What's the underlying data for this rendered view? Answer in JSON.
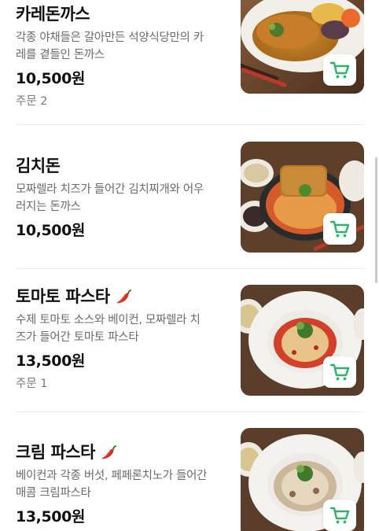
{
  "colors": {
    "accent": "#2fb36b",
    "pepper": "#d9321f"
  },
  "items": [
    {
      "name": "카레돈까스",
      "desc_line1": "각종 야채들은 갈아만든 석양식당만의 카",
      "desc_line2": "레를 곁들인 돈까스",
      "price": "10,500원",
      "order": "주문 2",
      "spicy": false,
      "image": "curry-tonkatsu-photo"
    },
    {
      "name": "김치돈",
      "desc_line1": "모짜렐라 치즈가 들어간 김치찌개와 어우",
      "desc_line2": "러지는 돈까스",
      "price": "10,500원",
      "order": "",
      "spicy": false,
      "image": "kimchi-tonkatsu-photo"
    },
    {
      "name": "토마토 파스타",
      "desc_line1": "수제 토마토 소스와 베이컨, 모짜렐라 치",
      "desc_line2": "즈가 들어간 토마토 파스타",
      "price": "13,500원",
      "order": "주문 1",
      "spicy": true,
      "image": "tomato-pasta-photo"
    },
    {
      "name": "크림 파스타",
      "desc_line1": "베이컨과 각종 버섯, 페페론치노가 들어간",
      "desc_line2": "매콤 크림파스타",
      "price": "13,500원",
      "order": "",
      "spicy": true,
      "image": "cream-pasta-photo"
    }
  ]
}
